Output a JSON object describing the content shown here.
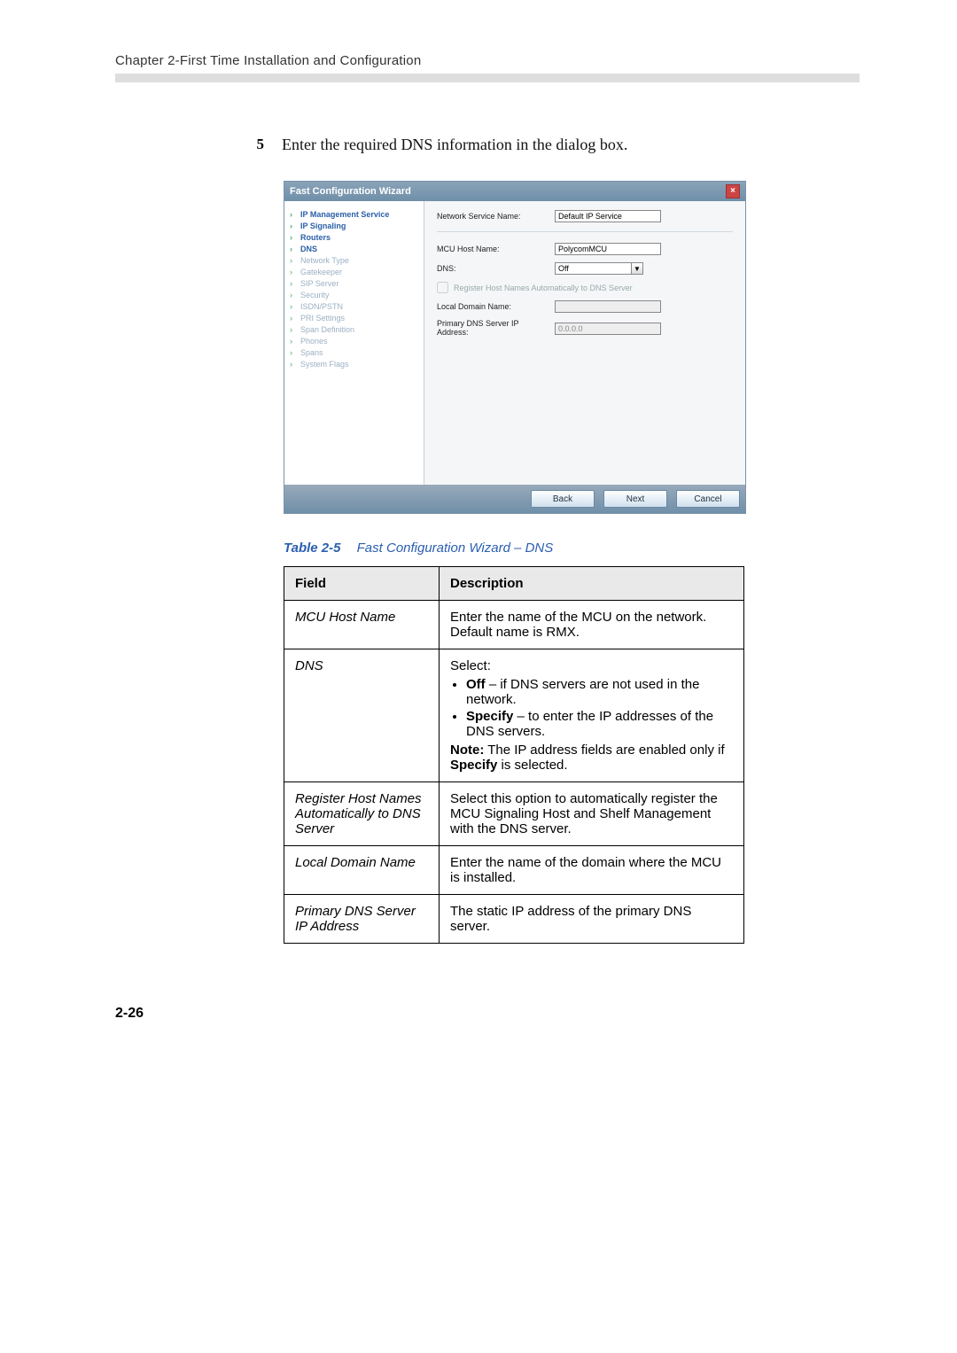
{
  "chapter_header": "Chapter 2-First Time Installation and Configuration",
  "step": {
    "number": "5",
    "text": "Enter the required DNS information in the dialog box."
  },
  "wizard": {
    "title": "Fast Configuration Wizard",
    "sidebar": [
      {
        "label": "IP Management Service",
        "state": "past"
      },
      {
        "label": "IP Signaling",
        "state": "past"
      },
      {
        "label": "Routers",
        "state": "past"
      },
      {
        "label": "DNS",
        "state": "current"
      },
      {
        "label": "Network Type",
        "state": "future"
      },
      {
        "label": "Gatekeeper",
        "state": "future"
      },
      {
        "label": "SIP Server",
        "state": "future"
      },
      {
        "label": "Security",
        "state": "future"
      },
      {
        "label": "ISDN/PSTN",
        "state": "future"
      },
      {
        "label": "PRI Settings",
        "state": "future"
      },
      {
        "label": "Span Definition",
        "state": "future"
      },
      {
        "label": "Phones",
        "state": "future"
      },
      {
        "label": "Spans",
        "state": "future"
      },
      {
        "label": "System Flags",
        "state": "future"
      }
    ],
    "fields": {
      "network_service_label": "Network Service Name:",
      "network_service_value": "Default IP Service",
      "mcu_host_label": "MCU Host Name:",
      "mcu_host_value": "PolycomMCU",
      "dns_label": "DNS:",
      "dns_value": "Off",
      "register_checkbox_label": "Register Host Names Automatically to DNS Server",
      "local_domain_label": "Local Domain Name:",
      "local_domain_value": "",
      "primary_dns_label": "Primary DNS Server IP Address:",
      "primary_dns_value": "0.0.0.0"
    },
    "buttons": {
      "back": "Back",
      "next": "Next",
      "cancel": "Cancel"
    }
  },
  "caption": {
    "label": "Table 2-5",
    "text": "Fast Configuration Wizard – DNS"
  },
  "table": {
    "headers": {
      "field": "Field",
      "description": "Description"
    },
    "rows": [
      {
        "field": "MCU Host Name",
        "desc_plain": "Enter the name of the MCU on the network. Default name is RMX."
      },
      {
        "field": "DNS",
        "dns_intro": "Select:",
        "dns_off_bold": "Off",
        "dns_off_rest": " – if DNS servers are not used in the network.",
        "dns_spec_bold": "Specify",
        "dns_spec_rest": " – to enter the IP addresses of the DNS servers.",
        "dns_note_bold": "Note:",
        "dns_note_rest": " The IP address fields are enabled only if ",
        "dns_note_spec": "Specify",
        "dns_note_tail": " is selected."
      },
      {
        "field": "Register Host Names Automatically to DNS Server",
        "desc_plain": "Select this option to automatically register the MCU Signaling Host and Shelf Management with the DNS server."
      },
      {
        "field": "Local Domain Name",
        "desc_plain": "Enter the name of the domain where the MCU is installed."
      },
      {
        "field": "Primary DNS Server IP Address",
        "desc_plain": "The static IP address of the primary DNS server."
      }
    ]
  },
  "page_number": "2-26"
}
